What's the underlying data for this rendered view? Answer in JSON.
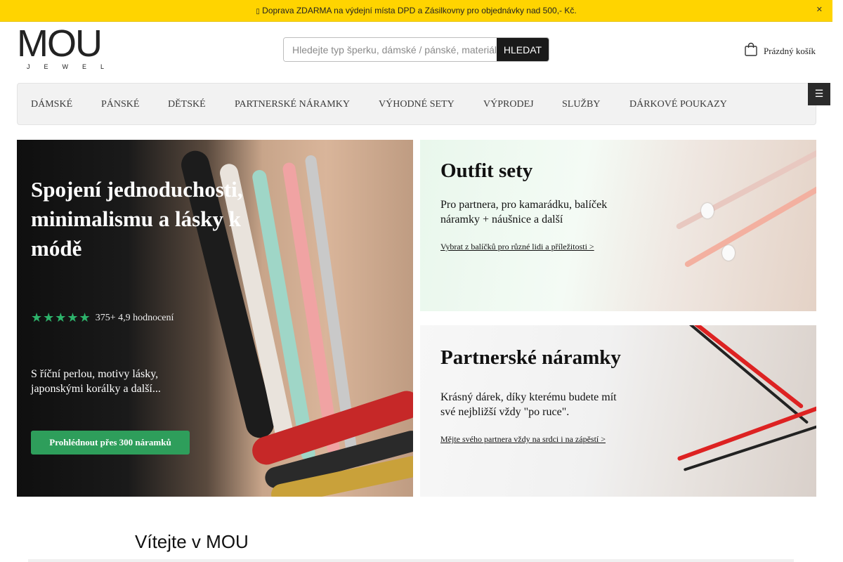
{
  "announcement": {
    "icon": "truck-icon",
    "text": "Doprava ZDARMA na výdejní místa DPD a Zásilkovny pro objednávky nad 500,- Kč.",
    "close_symbol": "✕"
  },
  "header": {
    "logo": {
      "word": "MOU",
      "sub": "JEWEL"
    },
    "search": {
      "placeholder": "Hledejte typ šperku, dámské / pánské, materiál...",
      "value": "",
      "button_label": "HLEDAT"
    },
    "cart": {
      "label": "Prázdný košík",
      "icon": "shopping-bag-icon"
    }
  },
  "nav": {
    "items": [
      {
        "label": "DÁMSKÉ"
      },
      {
        "label": "PÁNSKÉ"
      },
      {
        "label": "DĚTSKÉ"
      },
      {
        "label": "PARTNERSKÉ NÁRAMKY"
      },
      {
        "label": "VÝHODNÉ SETY"
      },
      {
        "label": "VÝPRODEJ"
      },
      {
        "label": "SLUŽBY"
      },
      {
        "label": "DÁRKOVÉ POUKAZY"
      }
    ],
    "toggle_symbol": "☰"
  },
  "hero": {
    "title": "Spojení jednoduchosti, minimalismu a lásky k módě",
    "stars": "★★★★★",
    "star_count": 5,
    "rating_text": "375+ 4,9 hodnocení",
    "description": "S říční perlou, motivy lásky, japonskými korálky a další...",
    "cta_label": "Prohlédnout přes 300 náramků",
    "accent_color": "#2e9e5b"
  },
  "promos": [
    {
      "title": "Outfit sety",
      "text": "Pro partnera, pro kamarádku, balíček náramky + náušnice a další",
      "link": "Vybrat z balíčků pro různé lidi a příležitosti >"
    },
    {
      "title": "Partnerské náramky",
      "text": "Krásný dárek, díky kterému budete mít své nejbližší vždy \"po ruce\".",
      "link": "Mějte svého partnera vždy na srdci i na zápěstí >"
    }
  ],
  "welcome": {
    "title": "Vítejte v MOU"
  },
  "colors": {
    "announcement_bg": "#ffd400",
    "search_button_bg": "#1a1a1a",
    "nav_bg": "#f2f2f2"
  }
}
